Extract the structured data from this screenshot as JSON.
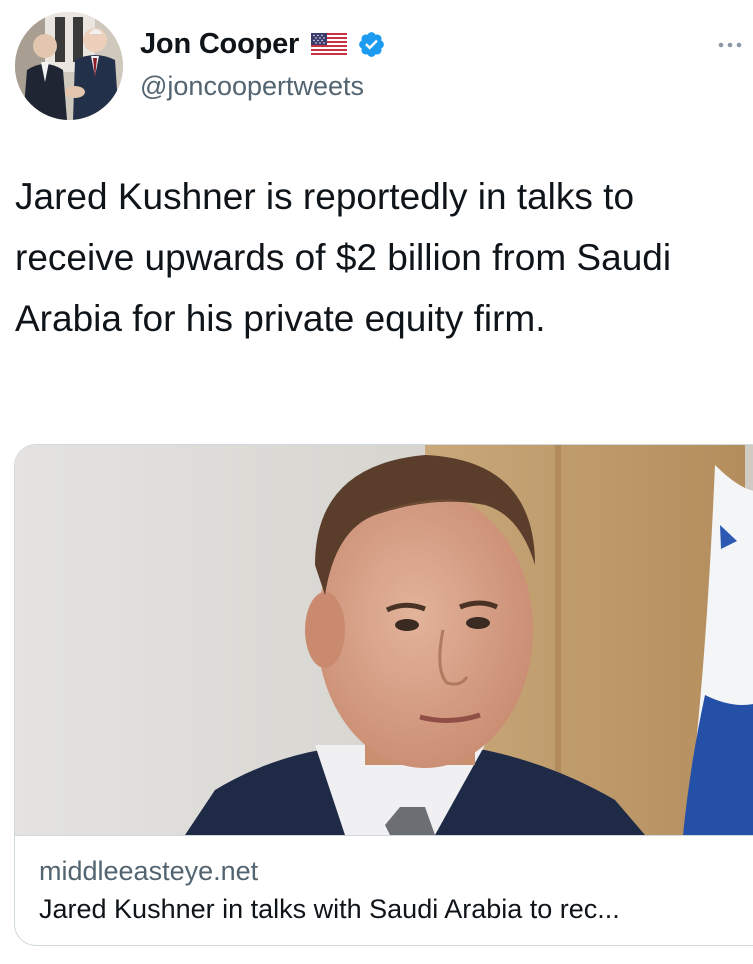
{
  "author": {
    "display_name": "Jon Cooper",
    "handle": "@joncoopertweets",
    "flag_icon": "us-flag-icon",
    "verified_icon": "verified-badge-icon",
    "verified_color": "#1d9bf0"
  },
  "tweet": {
    "text": "Jared Kushner is reportedly in talks to receive upwards of $2 billion from Saudi Arabia for his private equity firm."
  },
  "link_card": {
    "domain": "middleeasteye.net",
    "title": "Jared Kushner in talks with Saudi Arabia to rec..."
  },
  "menu": {
    "icon": "more-options-icon"
  },
  "colors": {
    "primary_text": "#0f1419",
    "secondary_text": "#536471",
    "border": "#cfd9de"
  }
}
